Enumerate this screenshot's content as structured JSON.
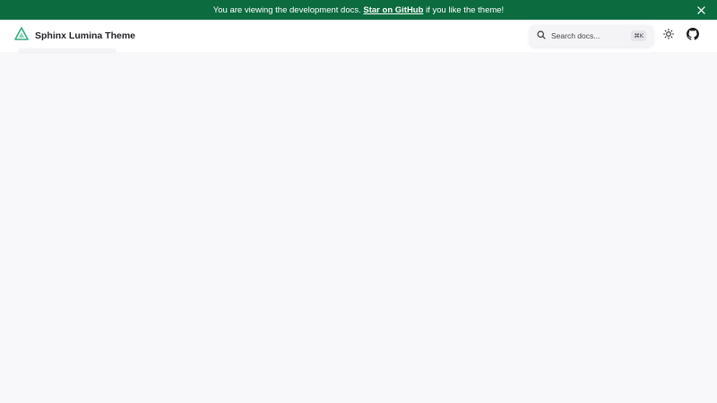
{
  "banner": {
    "text_before": "You are viewing the development docs.",
    "link_text": "Star on GitHub",
    "text_after": "if you like the theme!",
    "background": "#0c6b3f",
    "close_icon": "close-icon"
  },
  "header": {
    "site_title": "Sphinx Lumina Theme",
    "logo_icon": "triangle-logo-icon",
    "logo_color": "#2fae7a",
    "search": {
      "placeholder": "Search docs...",
      "shortcut": "⌘K",
      "icon": "search-icon"
    },
    "theme_toggle_icon": "sun-icon",
    "github_icon": "github-icon"
  }
}
